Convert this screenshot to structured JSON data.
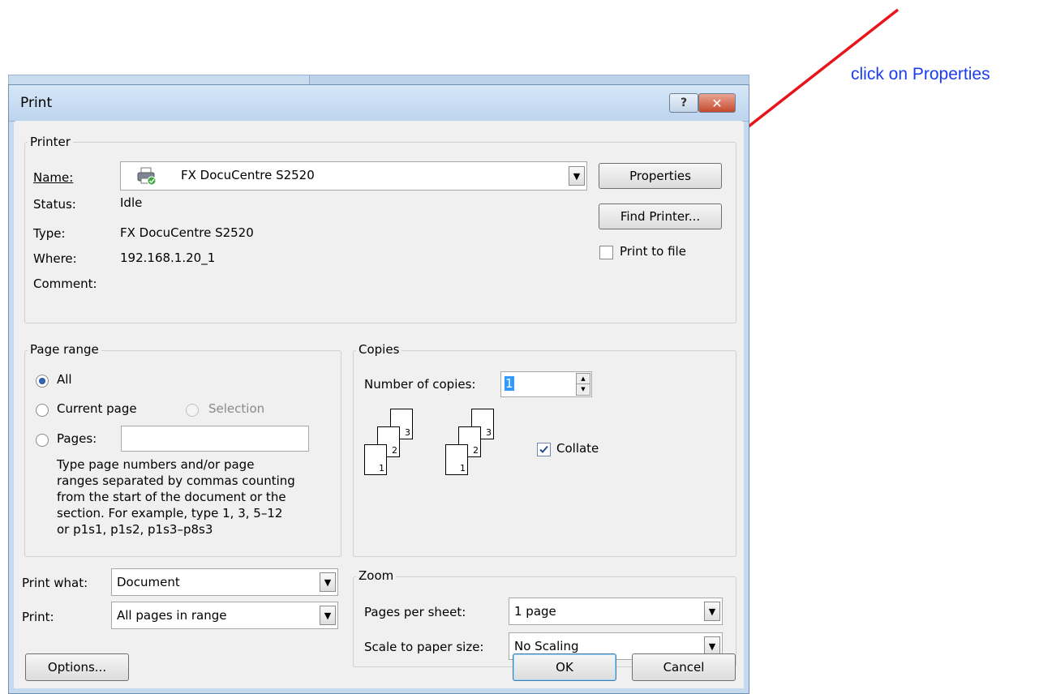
{
  "annotation": {
    "text": "click on Properties",
    "arrow_color": "#e8141c"
  },
  "dialog": {
    "title": "Print",
    "help_glyph": "?",
    "close_glyph": "✕",
    "printer": {
      "legend": "Printer",
      "name_label": "Name:",
      "name_value": "FX DocuCentre S2520",
      "status_label": "Status:",
      "status_value": "Idle",
      "type_label": "Type:",
      "type_value": "FX DocuCentre S2520",
      "where_label": "Where:",
      "where_value": "192.168.1.20_1",
      "comment_label": "Comment:",
      "properties_label": "Properties",
      "find_printer_label": "Find Printer...",
      "print_to_file_label": "Print to file",
      "print_to_file_checked": false
    },
    "page_range": {
      "legend": "Page range",
      "all_label": "All",
      "current_page_label": "Current page",
      "selection_label": "Selection",
      "pages_label": "Pages:",
      "pages_value": "",
      "help_lines": [
        "Type page numbers and/or page",
        "ranges separated by commas counting",
        "from the start of the document or the",
        "section. For example, type 1, 3, 5–12",
        "or p1s1, p1s2, p1s3–p8s3"
      ],
      "selected": "All"
    },
    "copies": {
      "legend": "Copies",
      "number_label": "Number of copies:",
      "number_value": "1",
      "collate_label": "Collate",
      "collate_checked": true,
      "page_numbers": [
        "3",
        "2",
        "1"
      ]
    },
    "print_what": {
      "label": "Print what:",
      "value": "Document"
    },
    "print": {
      "label": "Print:",
      "value": "All pages in range"
    },
    "zoom": {
      "legend": "Zoom",
      "pages_per_sheet_label": "Pages per sheet:",
      "pages_per_sheet_value": "1 page",
      "scale_label": "Scale to paper size:",
      "scale_value": "No Scaling"
    },
    "options_label": "Options...",
    "ok_label": "OK",
    "cancel_label": "Cancel"
  }
}
